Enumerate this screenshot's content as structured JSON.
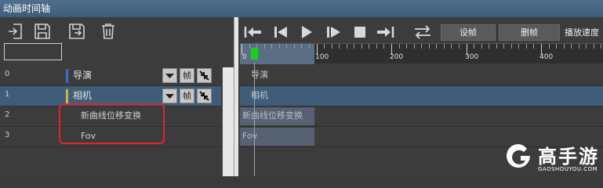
{
  "window": {
    "title": "动画时间轴"
  },
  "toolbar_left": {
    "icons": [
      "import-icon",
      "save-icon",
      "save-as-icon",
      "delete-icon"
    ],
    "name_input_value": ""
  },
  "tracks": [
    {
      "index": "0",
      "label": "导演",
      "color": "#3b6fd4",
      "selected": false,
      "button_label": "帧"
    },
    {
      "index": "1",
      "label": "相机",
      "color": "#d4b43b",
      "selected": true,
      "button_label": "帧"
    }
  ],
  "sub_tracks": [
    {
      "index": "2",
      "label": "新曲线位移变换"
    },
    {
      "index": "3",
      "label": "Fov"
    }
  ],
  "playback": {
    "icons": [
      "jump-start-icon",
      "step-back-icon",
      "play-icon",
      "step-forward-icon",
      "stop-icon",
      "jump-end-icon",
      "loop-icon"
    ],
    "set_frame_label": "设帧",
    "delete_frame_label": "删帧",
    "speed_label": "播放速度"
  },
  "ruler": {
    "labels": [
      "0",
      "100",
      "200",
      "300",
      "400"
    ],
    "playhead_frame": 10
  },
  "timeline_rows": [
    {
      "text": "导演",
      "selected": false
    },
    {
      "text": "相机",
      "selected": true
    }
  ],
  "clips": [
    {
      "text": "新曲线位移变换"
    },
    {
      "text": "Fov"
    }
  ],
  "watermark": {
    "cn": "高手游",
    "en": "GAOSHOUYOU.COM"
  }
}
